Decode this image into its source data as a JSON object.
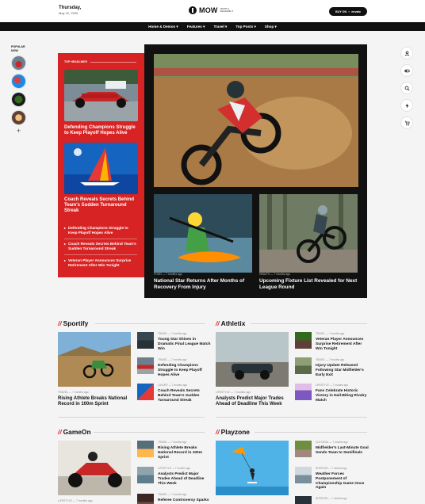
{
  "header": {
    "day": "Thursday,",
    "date": "May 22, 2025",
    "logo_text": "MOW",
    "logo_tag": "SPORT & MAGAZINE IT",
    "buy_label": "BUY ON",
    "buy_brand": "envato"
  },
  "nav": [
    {
      "label": "Home & Demos ▾"
    },
    {
      "label": "Features ▾"
    },
    {
      "label": "Travel ▾"
    },
    {
      "label": "Top Posts ▾"
    },
    {
      "label": "Shop ▾"
    }
  ],
  "popular": {
    "label": "POPULAR NOW",
    "plus": "+"
  },
  "rail_icons": [
    "user-icon",
    "toggle-icon",
    "search-icon",
    "bolt-icon",
    "cart-icon"
  ],
  "top_headlines": {
    "heading": "TOP HEADLINES",
    "story1": "Defending Champions Struggle to Keep Playoff Hopes Alive",
    "story2": "Coach Reveals Secrets Behind Team's Sudden Turnaround Streak",
    "bullets": [
      "Defending Champions Struggle to Keep Playoff Hopes Alive",
      "Coach Reveals Secrets Behind Team's Sudden Turnaround Streak",
      "Veteran Player Announces Surprise Retirement After Win Tonight"
    ]
  },
  "featured": {
    "left": {
      "meta": "FOOD  —  7 months ago",
      "title": "National Star Returns After Months of Recovery From Injury"
    },
    "right": {
      "meta": "HEALTH  —  7 months ago",
      "title": "Upcoming Fixture List Revealed for Next League Round"
    }
  },
  "sections": [
    {
      "name": "Sportify",
      "lead": {
        "meta": "TRAVEL  —  7 months ago",
        "title": "Rising Athlete Breaks National Record in 100m Sprint"
      },
      "minis": [
        {
          "meta": "TRAVEL  —  7 months ago",
          "title": "Young Star Shines in Dramatic Final League Match Win"
        },
        {
          "meta": "TRAVEL  —  7 months ago",
          "title": "Defending Champions Struggle to Keep Playoff Hopes Alive"
        },
        {
          "meta": "LUXURY  —  7 months ago",
          "title": "Coach Reveals Secrets Behind Team's Sudden Turnaround Streak"
        }
      ]
    },
    {
      "name": "Athletix",
      "lead": {
        "meta": "LIFESTYLE  —  7 months ago",
        "title": "Analysts Predict Major Trades Ahead of Deadline This Week"
      },
      "minis": [
        {
          "meta": "TRAVEL  —  7 months ago",
          "title": "Veteran Player Announces Surprise Retirement After Win Tonight"
        },
        {
          "meta": "TRAVEL  —  7 months ago",
          "title": "Injury Update Released Following Star Midfielder's Early Exit"
        },
        {
          "meta": "LIFESTYLE  —  7 months ago",
          "title": "Fans Celebrate Historic Victory in Nail-Biting Rivalry Match"
        }
      ]
    },
    {
      "name": "GameOn",
      "lead": {
        "meta": "LIFESTYLE  —  7 months ago",
        "title": ""
      },
      "minis": [
        {
          "meta": "TRAVEL  —  7 months ago",
          "title": "Rising Athlete Breaks National Record in 100m Sprint"
        },
        {
          "meta": "LIFESTYLE  —  7 months ago",
          "title": "Analysts Predict Major Trades Ahead of Deadline This Week"
        },
        {
          "meta": "TRAVEL  —  7 months ago",
          "title": "Referee Controversy Sparks"
        }
      ]
    },
    {
      "name": "Playzone",
      "lead": {
        "meta": "",
        "title": ""
      },
      "minis": [
        {
          "meta": "CULTURAL  —  7 months ago",
          "title": "Midfielder's Last-Minute Goal Sends Team to Semifinals"
        },
        {
          "meta": "INTERIOR  —  7 months ago",
          "title": "Weather Forces Postponement of Championship Game Once Again"
        },
        {
          "meta": "INTERIOR  —  7 months ago",
          "title": ""
        }
      ]
    }
  ]
}
